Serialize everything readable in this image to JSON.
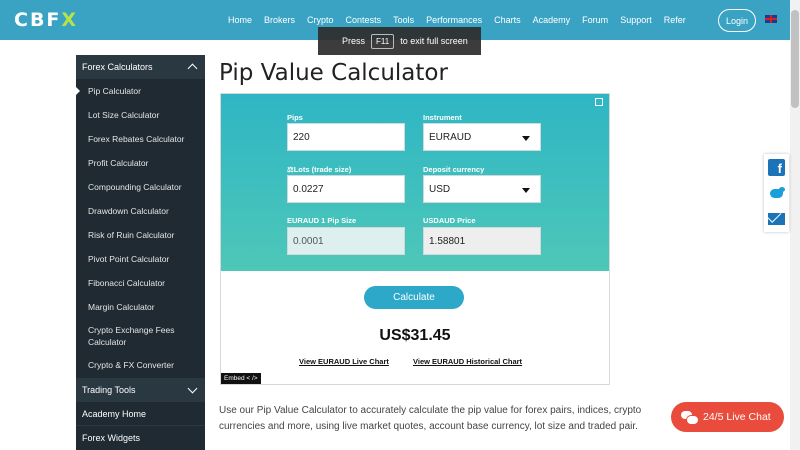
{
  "header": {
    "logo_main": "CBF",
    "logo_x": "X",
    "nav": [
      "Home",
      "Brokers",
      "Crypto",
      "Contests",
      "Tools",
      "Performances",
      "Charts",
      "Academy",
      "Forum",
      "Support",
      "Refer"
    ],
    "login": "Login"
  },
  "toast": {
    "before": "Press",
    "key": "F11",
    "after": "to exit full screen"
  },
  "sidebar": {
    "section": "Forex Calculators",
    "items": [
      "Pip Calculator",
      "Lot Size Calculator",
      "Forex Rebates Calculator",
      "Profit Calculator",
      "Compounding Calculator",
      "Drawdown Calculator",
      "Risk of Ruin Calculator",
      "Pivot Point Calculator",
      "Fibonacci Calculator",
      "Margin Calculator",
      "Crypto Exchange Fees Calculator",
      "Crypto & FX Converter"
    ],
    "trading_tools": "Trading Tools",
    "academy_home": "Academy Home",
    "forex_widgets": "Forex Widgets"
  },
  "page": {
    "title": "Pip Value Calculator"
  },
  "calculator": {
    "pips_label": "Pips",
    "pips_value": "220",
    "instrument_label": "Instrument",
    "instrument_value": "EURAUD",
    "lots_label": "⚖Lots (trade size)",
    "lots_value": "0.0227",
    "deposit_label": "Deposit currency",
    "deposit_value": "USD",
    "pip_size_label": "EURAUD 1 Pip Size",
    "pip_size_value": "0.0001",
    "price_label": "USDAUD Price",
    "price_value": "1.58801",
    "calculate": "Calculate",
    "result": "US$31.45",
    "live_chart": "View EURAUD Live Chart",
    "hist_chart": "View EURAUD Historical Chart",
    "embed": "Embed < />"
  },
  "body": {
    "text": "Use our Pip Value Calculator to accurately calculate the pip value for forex pairs, indices, crypto currencies and more, using live market quotes, account base currency, lot size and traded pair."
  },
  "chat": {
    "label": "24/5 Live Chat"
  },
  "colors": {
    "header": "#3aa3c4",
    "sidebar": "#1f2a32",
    "calc_gradient_top": "#2eb6c4",
    "calc_gradient_bottom": "#4ec7b8",
    "chat": "#e94b3c"
  }
}
